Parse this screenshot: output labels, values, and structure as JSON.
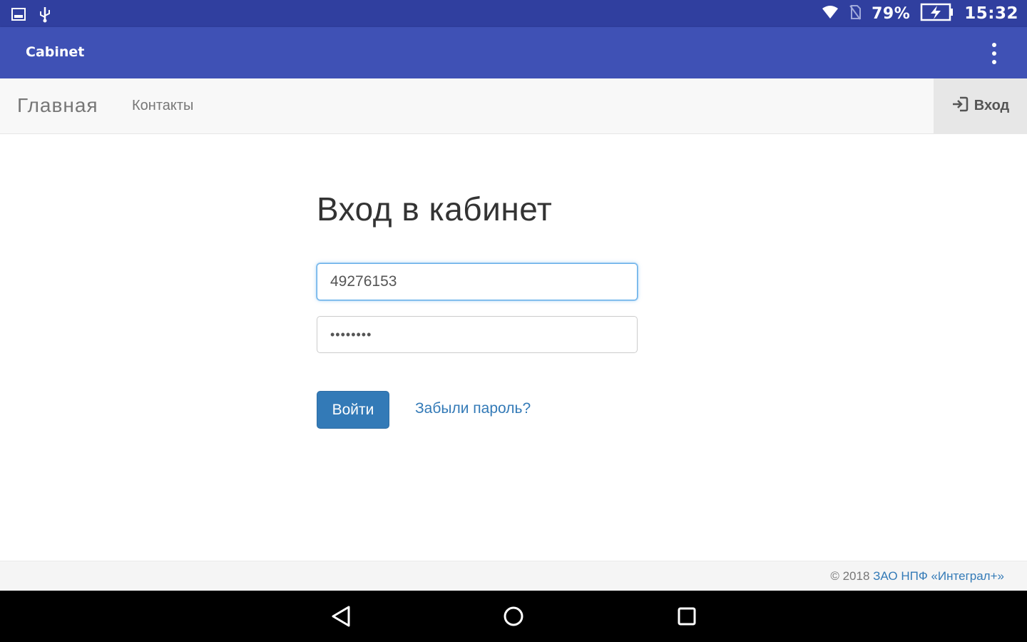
{
  "status_bar": {
    "icons_left": [
      "gallery-icon",
      "usb-icon"
    ],
    "icons_right": [
      "wifi-icon",
      "no-sim-icon",
      "battery-charging-icon"
    ],
    "battery_percent": "79%",
    "time": "15:32"
  },
  "app_bar": {
    "title": "Cabinet",
    "menu_icon": "more-vertical-icon"
  },
  "navbar": {
    "brand": "Главная",
    "links": [
      {
        "label": "Контакты"
      }
    ],
    "login": {
      "label": "Вход",
      "icon": "sign-in-icon"
    }
  },
  "form": {
    "heading": "Вход в кабинет",
    "login_value": "49276153",
    "password_value": "••••••••",
    "submit_label": "Войти",
    "forgot_label": "Забыли пароль?"
  },
  "footer": {
    "copyright": "© 2018 ",
    "company": "ЗАО НПФ «Интеграл+»"
  },
  "system_nav": {
    "icons": [
      "back-icon",
      "home-icon",
      "recent-apps-icon"
    ]
  },
  "colors": {
    "status_bar": "#303f9f",
    "app_bar": "#3f51b5",
    "primary_button": "#337ab7",
    "link": "#337ab7"
  }
}
